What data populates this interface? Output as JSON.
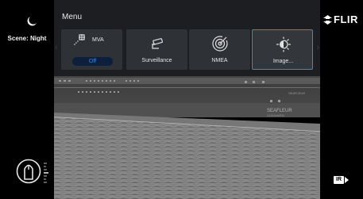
{
  "scene": {
    "label": "Scene: Night",
    "icon": "moon-icon"
  },
  "brand": {
    "logo_text": "FLIR",
    "icon": "flir-logo-icon"
  },
  "menu": {
    "title": "Menu",
    "items": [
      {
        "label": "MVA",
        "icon": "mva-target-icon",
        "toggle_value": "Off"
      },
      {
        "label": "Surveillance",
        "icon": "surveillance-camera-icon"
      },
      {
        "label": "NMEA",
        "icon": "nmea-radar-icon"
      },
      {
        "label": "Image...",
        "icon": "image-brightness-icon",
        "selected": true
      }
    ],
    "left_arrow_icon": "chevron-left-icon",
    "right_arrow_icon": "chevron-right-icon"
  },
  "video": {
    "ship_text_1": "SEAFLEUR",
    "ship_text_2": "SEAFLEUR",
    "ship_text_3": "CUXHAVEN"
  },
  "status": {
    "mode_badge": "IR",
    "mode_icon": "ir-camera-icon"
  },
  "compass": {
    "icon": "vessel-heading-icon"
  },
  "colors": {
    "accent": "#2a8fd8",
    "toggle_text": "#3d8be0",
    "panel": "#1c1e22",
    "tile": "#2e3136"
  }
}
